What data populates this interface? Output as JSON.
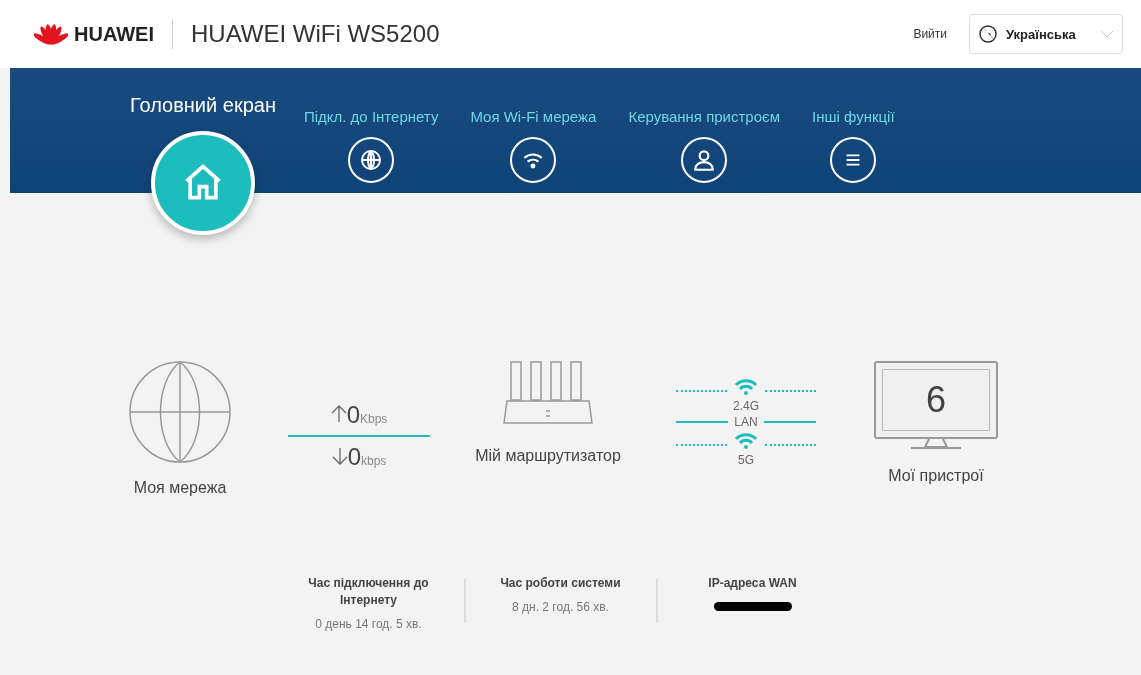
{
  "header": {
    "brand": "HUAWEI",
    "title": "HUAWEI WiFi WS5200",
    "logout": "Вийти",
    "language": "Українська"
  },
  "nav": [
    {
      "label": "Головний екран",
      "selected": true
    },
    {
      "label": "Підкл. до Інтернету",
      "selected": false
    },
    {
      "label": "Моя Wi-Fi мережа",
      "selected": false
    },
    {
      "label": "Керування пристроєм",
      "selected": false
    },
    {
      "label": "Інші функції",
      "selected": false
    }
  ],
  "topology": {
    "network_label": "Моя мережа",
    "upload": {
      "value": "0",
      "unit": "Kbps"
    },
    "download": {
      "value": "0",
      "unit": "kbps"
    },
    "router_label": "Мій маршрутизатор",
    "connections": [
      {
        "kind": "wifi",
        "label": "2.4G"
      },
      {
        "kind": "lan",
        "label": "LAN"
      },
      {
        "kind": "wifi",
        "label": "5G"
      }
    ],
    "device_count": "6",
    "devices_label": "Мої пристрої"
  },
  "stats": [
    {
      "title": "Час підключення до Інтернету",
      "value": "0 день 14 год. 5 хв.",
      "kind": "text"
    },
    {
      "title": "Час роботи системи",
      "value": "8 дн. 2 год. 56 хв.",
      "kind": "text"
    },
    {
      "title": "IP-адреса WAN",
      "kind": "redacted"
    }
  ]
}
